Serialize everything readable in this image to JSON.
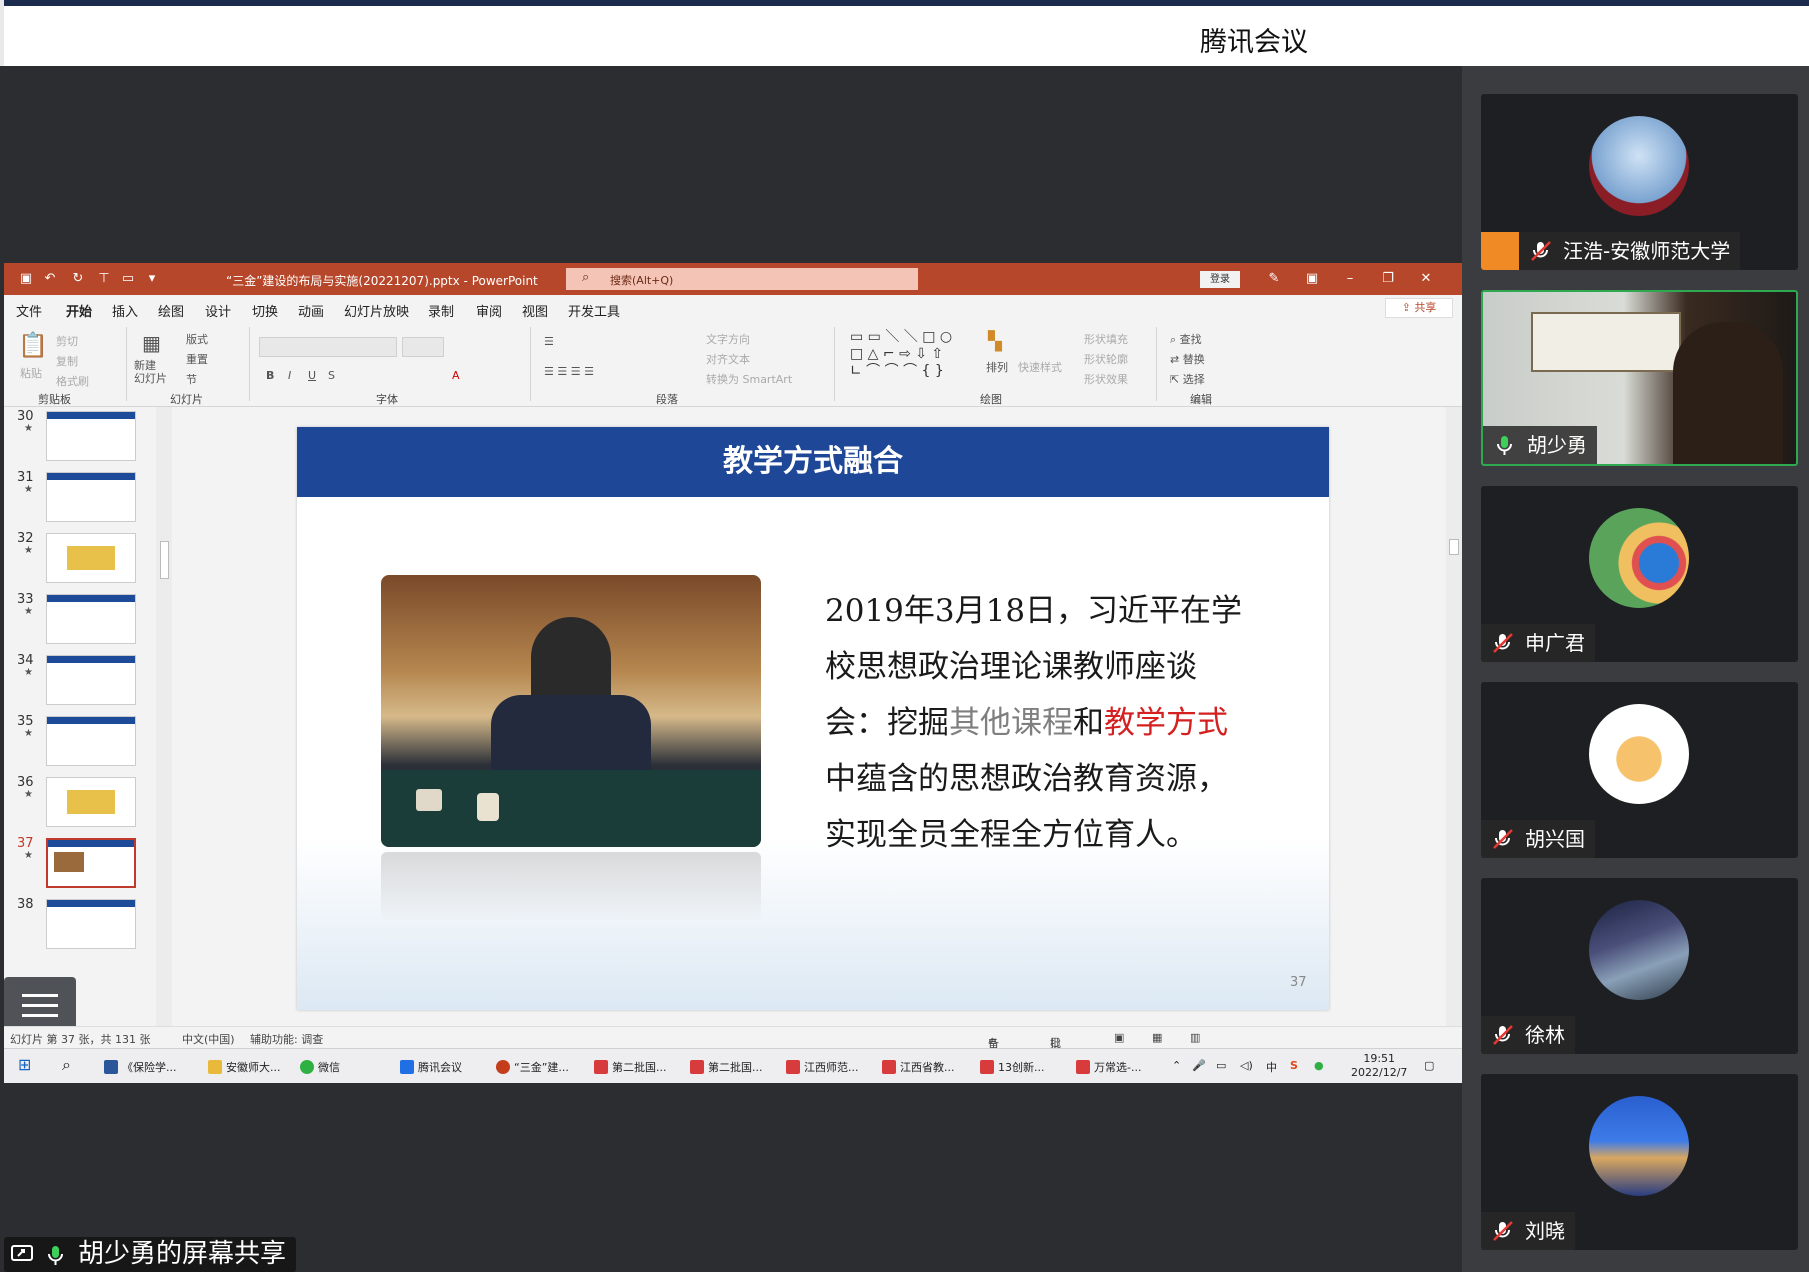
{
  "meeting": {
    "title": "腾讯会议"
  },
  "powerpoint": {
    "doc_title": "“三金”建设的布局与实施(20221207).pptx  -  PowerPoint",
    "search_placeholder": "搜索(Alt+Q)",
    "login_label": "登录",
    "share_label": "共享",
    "menu": [
      "文件",
      "开始",
      "插入",
      "绘图",
      "设计",
      "切换",
      "动画",
      "幻灯片放映",
      "录制",
      "审阅",
      "视图",
      "开发工具"
    ],
    "ribbon": {
      "clipboard": {
        "label": "剪贴板",
        "paste": "粘贴",
        "cut": "剪切",
        "copy": "复制",
        "format_painter": "格式刷"
      },
      "slides": {
        "label": "幻灯片",
        "new_slide": "新建\n幻灯片",
        "layout": "版式",
        "reset": "重置",
        "section": "节"
      },
      "font": {
        "label": "字体"
      },
      "paragraph": {
        "label": "段落",
        "text_direction": "文字方向",
        "align_text": "对齐文本",
        "smartart": "转换为 SmartArt"
      },
      "drawing": {
        "label": "绘图",
        "arrange": "排列",
        "quick_styles": "快速样式",
        "shape_fill": "形状填充",
        "shape_outline": "形状轮廓",
        "shape_effects": "形状效果"
      },
      "editing": {
        "label": "编辑",
        "find": "查找",
        "replace": "替换",
        "select": "选择"
      }
    },
    "thumbnails": [
      30,
      31,
      32,
      33,
      34,
      35,
      36,
      37,
      38
    ],
    "selected_slide": 37,
    "slide": {
      "heading": "教学方式融合",
      "text_parts": [
        "2019年3月18日，习近平在学校思想政治理论课教师座谈会：挖掘",
        "其他课程",
        "和",
        "教学方式",
        "中蕴含的思想政治教育资源，实现全员全程全方位育人。"
      ],
      "page_number": "37"
    },
    "status": {
      "slide_info": "幻灯片 第 37 张，共 131 张",
      "language": "中文(中国)",
      "accessibility": "辅助功能: 调查",
      "notes": "备注",
      "comments": "批注"
    }
  },
  "taskbar": {
    "items": [
      "《保险学...",
      "安徽师大...",
      "微信",
      "腾讯会议",
      "“三金”建...",
      "第二批国...",
      "第二批国...",
      "江西师范...",
      "江西省教...",
      "13创新...",
      "万常选-..."
    ],
    "ime": "中",
    "time": "19:51",
    "date": "2022/12/7"
  },
  "participants": [
    {
      "name": "汪浩-安徽师范大学",
      "muted": true
    },
    {
      "name": "胡少勇",
      "muted": false,
      "speaking": true
    },
    {
      "name": "申广君",
      "muted": true
    },
    {
      "name": "胡兴国",
      "muted": true
    },
    {
      "name": "徐林",
      "muted": true
    },
    {
      "name": "刘晓",
      "muted": true
    }
  ],
  "screen_share_label": "胡少勇的屏幕共享",
  "colors": {
    "ppt_accent": "#b7472a",
    "slide_header": "#1e4797",
    "highlight_red": "#d42020",
    "speaking_border": "#2fa84f"
  }
}
